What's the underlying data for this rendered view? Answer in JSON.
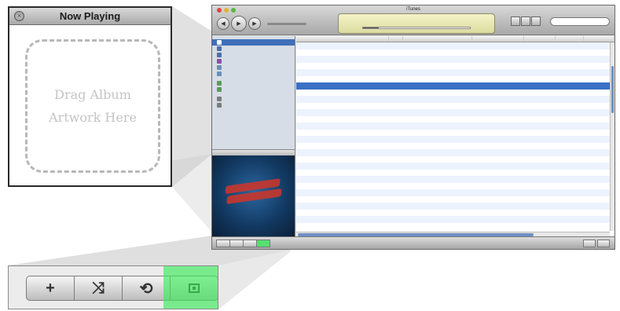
{
  "now_playing": {
    "title": "Now Playing",
    "drop_line1": "Drag Album",
    "drop_line2": "Artwork Here"
  },
  "button_bar": {
    "buttons": [
      {
        "icon": "plus-icon",
        "glyph": "+"
      },
      {
        "icon": "shuffle-icon",
        "glyph": "⤨"
      },
      {
        "icon": "repeat-icon",
        "glyph": "⟲"
      },
      {
        "icon": "artwork-toggle-icon",
        "glyph": ""
      }
    ],
    "highlight_color": "#3ceb5a"
  },
  "itunes": {
    "window_title": "iTunes",
    "colors": {
      "selection": "#3b70c7",
      "sidebar_bg": "#d6dde6",
      "lcd": "#f3f3c8"
    }
  }
}
